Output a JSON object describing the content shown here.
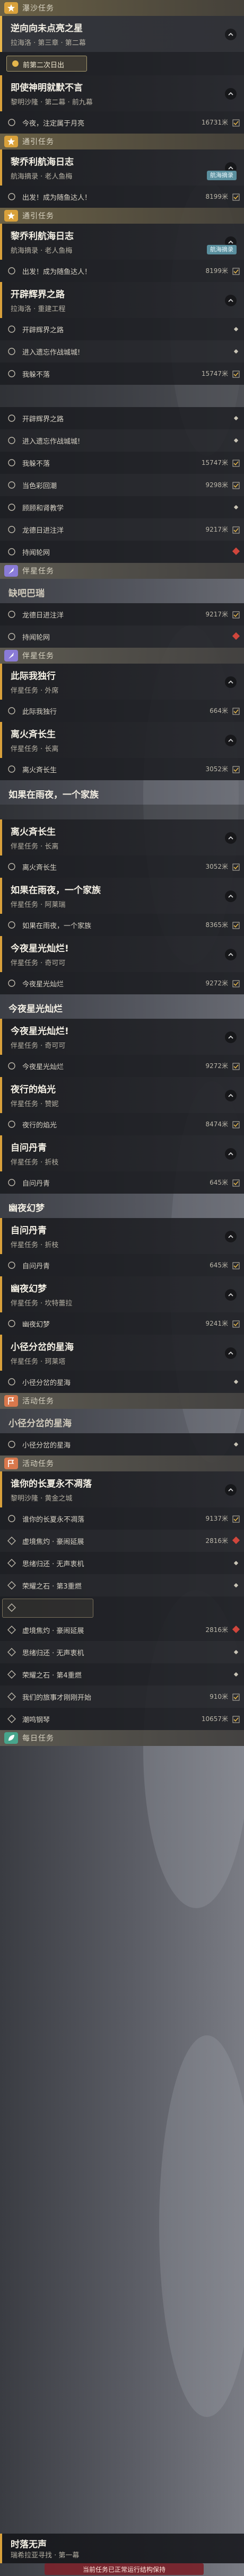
{
  "colors": {
    "main": "#d9a13b",
    "extra": "#8a7bd6",
    "side": "#8a7bd6",
    "event": "#d9784c",
    "daily": "#48a58c",
    "tip": "#5a8f9e",
    "warn": "#d0463c"
  },
  "elements": [
    {
      "t": "sec",
      "icon": "star",
      "color": "#d9a13b",
      "label": "瀑沙任务",
      "cls": "main"
    },
    {
      "t": "card",
      "title": "逆向向未点亮之星",
      "sub": "拉海洛 · 第三章 · 第二幕",
      "hl": true
    },
    {
      "t": "chip",
      "label": "前第二次日出"
    },
    {
      "t": "card",
      "title": "即使神明就默不言",
      "sub": "黎明沙隆 · 第二幕 · 前九幕"
    },
    {
      "t": "row",
      "text": "今夜，注定属于月亮",
      "dist": "16731米",
      "mk": "circle",
      "trk": "check"
    },
    {
      "t": "sec",
      "icon": "star",
      "color": "#d9a13b",
      "label": "通引任务",
      "cls": "main"
    },
    {
      "t": "card",
      "title": "黎乔利航海日志",
      "sub": "航海摘录 · 老人鱼梅",
      "tip": "航海摘录"
    },
    {
      "t": "row",
      "text": "出发！成为随鱼达人！",
      "dist": "8199米",
      "mk": "circle",
      "trk": "check"
    },
    {
      "t": "sec",
      "icon": "star",
      "color": "#d9a13b",
      "label": "通引任务",
      "cls": "main"
    },
    {
      "t": "card",
      "title": "黎乔利航海日志",
      "sub": "航海摘录 · 老人鱼梅",
      "tip": "航海摘录"
    },
    {
      "t": "row",
      "text": "出发！成为随鱼达人！",
      "dist": "8199米",
      "mk": "circle",
      "trk": "check"
    },
    {
      "t": "card",
      "title": "开辟辉界之路",
      "sub": "拉海洛 · 重建工程"
    },
    {
      "t": "row",
      "text": "开辟辉界之路",
      "mk": "circle",
      "trk": "dot"
    },
    {
      "t": "row",
      "text": "进入遗忘作战城城!",
      "mk": "circle",
      "trk": "dot",
      "alt": true
    },
    {
      "t": "row",
      "text": "我躲不落",
      "dist": "15747米",
      "mk": "circle",
      "trk": "check"
    },
    {
      "t": "gap"
    },
    {
      "t": "row",
      "text": "开辟辉界之路",
      "mk": "circle",
      "trk": "dot"
    },
    {
      "t": "row",
      "text": "进入遗忘作战城城!",
      "mk": "circle",
      "trk": "dot",
      "alt": true
    },
    {
      "t": "row",
      "text": "我躲不落",
      "dist": "15747米",
      "mk": "circle",
      "trk": "check"
    },
    {
      "t": "row",
      "text": "当色彩回潮",
      "dist": "9298米",
      "mk": "circle",
      "trk": "check",
      "alt": true
    },
    {
      "t": "row",
      "text": "顾顾和肾教学",
      "mk": "circle",
      "trk": "dot"
    },
    {
      "t": "row",
      "text": "龙德日进注洋",
      "dist": "9217米",
      "mk": "circle",
      "trk": "check",
      "alt": true
    },
    {
      "t": "row",
      "text": "持闻轮网",
      "mk": "circle",
      "trk": "red"
    },
    {
      "t": "sec",
      "icon": "quill",
      "color": "#8a7bd6",
      "label": "伴星任务",
      "cls": ""
    },
    {
      "t": "banner",
      "text": "缺吧巴瑞",
      "ghost": true
    },
    {
      "t": "row",
      "text": "龙德日进注洋",
      "dist": "9217米",
      "mk": "circle",
      "trk": "check"
    },
    {
      "t": "row",
      "text": "持闻轮网",
      "mk": "circle",
      "trk": "red",
      "alt": true
    },
    {
      "t": "sec",
      "icon": "quill",
      "color": "#8a7bd6",
      "label": "伴星任务",
      "cls": ""
    },
    {
      "t": "card",
      "title": "此际我独行",
      "sub": "伴星任务 · 外席"
    },
    {
      "t": "row",
      "text": "此际我独行",
      "dist": "664米",
      "mk": "circle",
      "trk": "check"
    },
    {
      "t": "card",
      "title": "离火斉长生",
      "sub": "伴星任务 · 长离"
    },
    {
      "t": "row",
      "text": "离火斉长生",
      "dist": "3052米",
      "mk": "circle",
      "trk": "check"
    },
    {
      "t": "banner",
      "text": "如果在雨夜，一个家族"
    },
    {
      "t": "gap2"
    },
    {
      "t": "card",
      "title": "离火斉长生",
      "sub": "伴星任务 · 长离"
    },
    {
      "t": "row",
      "text": "离火斉长生",
      "dist": "3052米",
      "mk": "circle",
      "trk": "check"
    },
    {
      "t": "card",
      "title": "如果在雨夜，一个家族",
      "sub": "伴星任务 · 阿莱瑞"
    },
    {
      "t": "row",
      "text": "如果在雨夜，一个家族",
      "dist": "8365米",
      "mk": "circle",
      "trk": "check"
    },
    {
      "t": "card",
      "title": "今夜星光灿烂!",
      "sub": "伴星任务 · 奇可可"
    },
    {
      "t": "row",
      "text": "今夜星光灿烂",
      "dist": "9272米",
      "mk": "circle",
      "trk": "check"
    },
    {
      "t": "banner",
      "text": "今夜星光灿烂"
    },
    {
      "t": "card",
      "title": "今夜星光灿烂!",
      "sub": "伴星任务 · 奇可可"
    },
    {
      "t": "row",
      "text": "今夜星光灿烂",
      "dist": "9272米",
      "mk": "circle",
      "trk": "check"
    },
    {
      "t": "card",
      "title": "夜行的焰光",
      "sub": "伴星任务 · 赞妮"
    },
    {
      "t": "row",
      "text": "夜行的焰光",
      "dist": "8474米",
      "mk": "circle",
      "trk": "check"
    },
    {
      "t": "card",
      "title": "自问丹青",
      "sub": "伴星任务 · 折枝"
    },
    {
      "t": "row",
      "text": "自问丹青",
      "dist": "645米",
      "mk": "circle",
      "trk": "check"
    },
    {
      "t": "banner",
      "text": "幽夜幻梦"
    },
    {
      "t": "card",
      "title": "自问丹青",
      "sub": "伴星任务 · 折枝"
    },
    {
      "t": "row",
      "text": "自问丹青",
      "dist": "645米",
      "mk": "circle",
      "trk": "check"
    },
    {
      "t": "card",
      "title": "幽夜幻梦",
      "sub": "伴星任务 · 坎特蕾拉"
    },
    {
      "t": "row",
      "text": "幽夜幻梦",
      "dist": "9241米",
      "mk": "circle",
      "trk": "check"
    },
    {
      "t": "card",
      "title": "小径分岔的星海",
      "sub": "伴星任务 · 珂莱塔"
    },
    {
      "t": "row",
      "text": "小径分岔的星海",
      "mk": "circle",
      "trk": "dot"
    },
    {
      "t": "sec",
      "icon": "flag",
      "color": "#d9784c",
      "label": "活动任务",
      "cls": ""
    },
    {
      "t": "banner",
      "text": "小径分岔的星海",
      "ghost": true
    },
    {
      "t": "row",
      "text": "小径分岔的星海",
      "mk": "circle",
      "trk": "dot"
    },
    {
      "t": "sec",
      "icon": "flag",
      "color": "#d9784c",
      "label": "活动任务",
      "cls": ""
    },
    {
      "t": "card",
      "title": "谁你的长夏永不凋落",
      "sub": "黎明沙隆 · 黄金之城"
    },
    {
      "t": "row",
      "text": "谁你的长夏永不凋落",
      "dist": "9137米",
      "mk": "circle",
      "trk": "check"
    },
    {
      "t": "row",
      "text": "虚境焦灼 · 豪闹延展",
      "dist": "2816米",
      "mk": "diamond",
      "trk": "red",
      "alt": true
    },
    {
      "t": "row",
      "text": "思绪归还 · 无声衷机",
      "mk": "diamond",
      "trk": "dot"
    },
    {
      "t": "row",
      "text": "荣耀之石 · 第3重燃",
      "mk": "diamond",
      "trk": "dot",
      "alt": true
    },
    {
      "t": "row",
      "text": "",
      "mk": "diamond",
      "trk": "none",
      "box": true
    },
    {
      "t": "row",
      "text": "虚境焦灼 · 豪闹延展",
      "dist": "2816米",
      "mk": "diamond",
      "trk": "red"
    },
    {
      "t": "row",
      "text": "思绪归还 · 无声衷机",
      "mk": "diamond",
      "trk": "dot",
      "alt": true
    },
    {
      "t": "row",
      "text": "荣耀之石 · 第4重燃",
      "mk": "diamond",
      "trk": "dot"
    },
    {
      "t": "row",
      "text": "我们的旅事才刚刚开始",
      "dist": "910米",
      "mk": "diamond",
      "trk": "check",
      "alt": true
    },
    {
      "t": "row",
      "text": "潮鸣钢琴",
      "dist": "10657米",
      "mk": "diamond",
      "trk": "check"
    },
    {
      "t": "sec",
      "icon": "leaf",
      "color": "#48a58c",
      "label": "每日任务",
      "cls": ""
    }
  ],
  "footer": {
    "title": "时落无声",
    "sub": "瑞希拉亚寻找 · 第一幕"
  },
  "toast": "当前任务已正常运行结构保持"
}
